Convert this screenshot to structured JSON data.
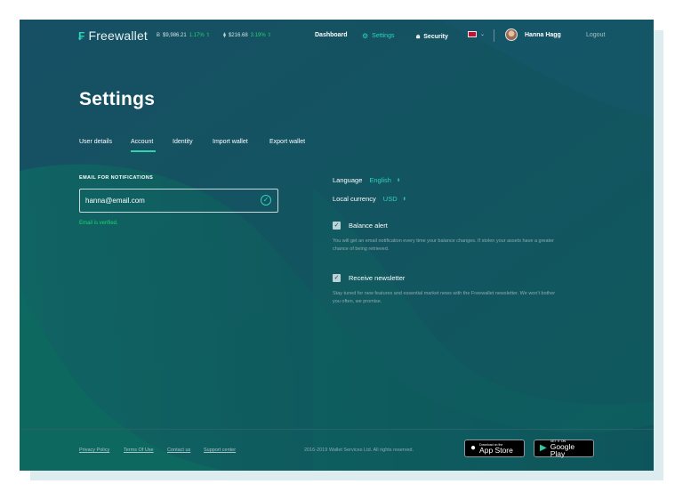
{
  "app": {
    "brand": "Freewallet"
  },
  "tickers": [
    {
      "symbol": "Ƀ",
      "price": "$9,986.21",
      "change": "1.17% ⇧"
    },
    {
      "symbol": "⧫",
      "price": "$216.68",
      "change": "3.19% ⇧"
    }
  ],
  "nav": {
    "dashboard": "Dashboard",
    "settings": "Settings",
    "security": "Security",
    "user": "Hanna Hagg",
    "logout": "Logout"
  },
  "page": {
    "title": "Settings",
    "tabs": [
      {
        "label": "User details",
        "active": false
      },
      {
        "label": "Account",
        "active": true
      },
      {
        "label": "Identity",
        "active": false
      },
      {
        "label": "Import wallet",
        "active": false
      },
      {
        "label": "Export wallet",
        "active": false
      }
    ]
  },
  "email": {
    "label": "EMAIL FOR NOTIFICATIONS",
    "value": "hanna@email.com",
    "status": "Email is verified."
  },
  "preferences": {
    "language_label": "Language",
    "language_value": "English",
    "currency_label": "Local currency",
    "currency_value": "USD",
    "balance_alert": {
      "label": "Balance alert",
      "checked": true,
      "description": "You will get an email notification every time your balance changes. If stolen your assets have a greater chance of being retrieved."
    },
    "newsletter": {
      "label": "Receive newsletter",
      "checked": true,
      "description": "Stay tuned for new features and essential market news with the Freewallet newsletter. We won't bother you often, we promise."
    }
  },
  "footer": {
    "links": [
      "Privacy Policy",
      "Terms Of Use",
      "Contact us",
      "Support center"
    ],
    "copyright": "2016-2019 Wallet Services Ltd. All rights reserved.",
    "app_store_small": "Download on the",
    "app_store_big": "App Store",
    "google_play_small": "GET IT ON",
    "google_play_big": "Google Play"
  },
  "colors": {
    "background": "#13465a",
    "accent": "#2ed3b6",
    "success": "#1fd36f"
  }
}
